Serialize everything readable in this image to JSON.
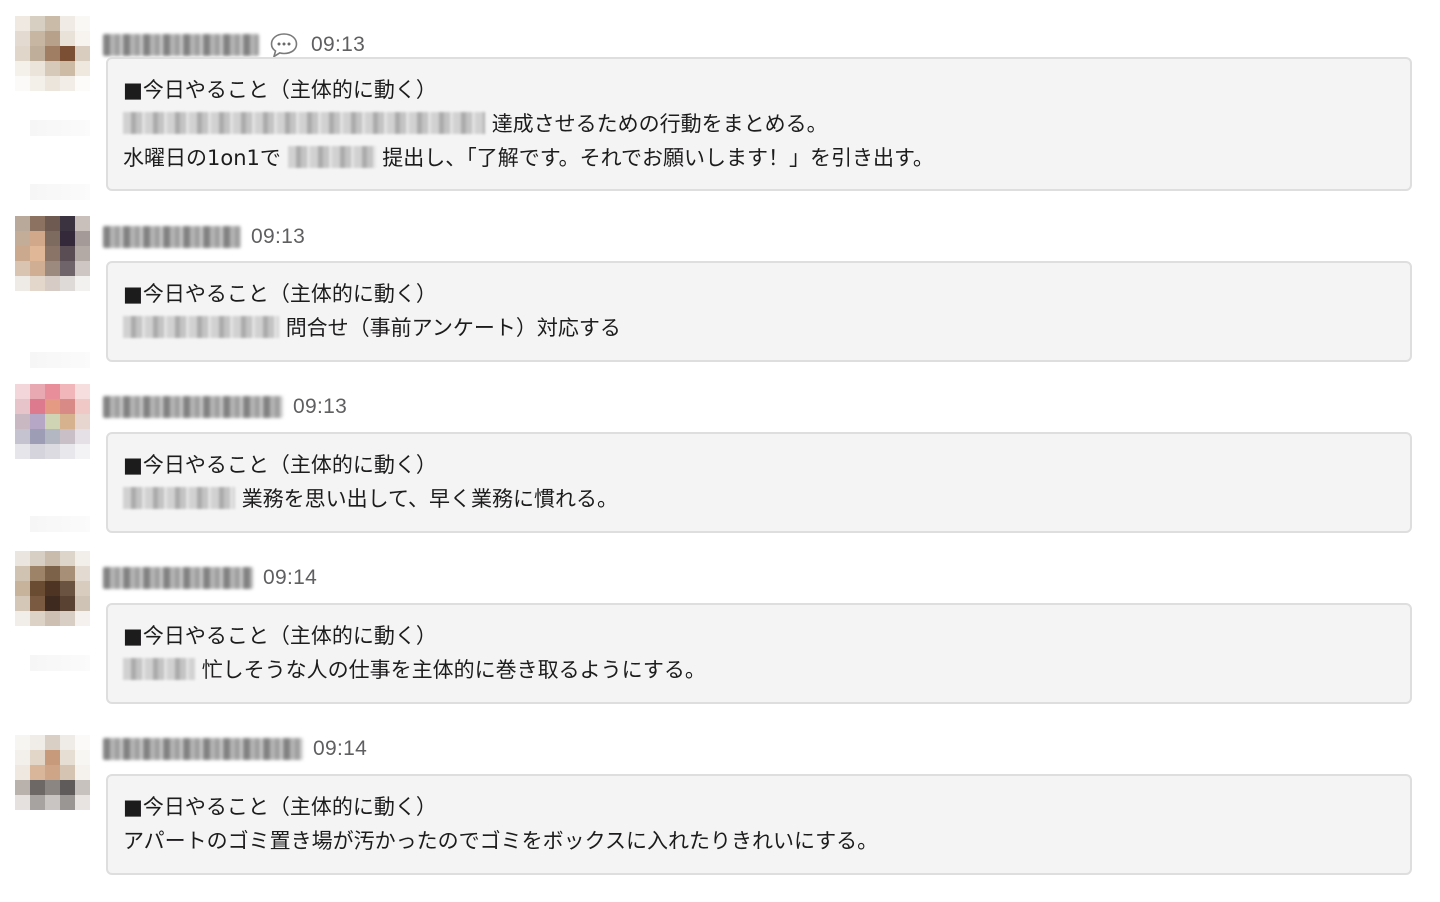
{
  "messages": [
    {
      "time": "09:13",
      "has_thread_icon": true,
      "avatar_colors": [
        "#efe9e1",
        "#d8cfc3",
        "#cabba8",
        "#f0ebe4",
        "#faf8f5",
        "#e3dbd1",
        "#c7b6a1",
        "#b7a18a",
        "#e9e2d9",
        "#f7f4f0",
        "#e1d6ca",
        "#bfae99",
        "#9f7e63",
        "#7a4f33",
        "#d9cdbf",
        "#f4f0ea",
        "#ebe4da",
        "#d6c9b9",
        "#cdbba6",
        "#efe8df",
        "#fbfaf8",
        "#f3efe9",
        "#ece5dc",
        "#f2ede7",
        "#fcfbfa"
      ],
      "lines": [
        {
          "before": "■今日やること（主体的に動く）",
          "after": ""
        },
        {
          "before": "",
          "after": "達成させるための行動をまとめる。"
        },
        {
          "before": "水曜日の1on1で",
          "after": "提出し、「了解です。それでお願いします！」を引き出す。"
        }
      ]
    },
    {
      "time": "09:13",
      "has_thread_icon": false,
      "avatar_colors": [
        "#b9a99a",
        "#8c7361",
        "#6e5a50",
        "#3c3340",
        "#c9c0bb",
        "#c4ad98",
        "#d1a98a",
        "#7d6b60",
        "#33293a",
        "#a49b99",
        "#caa98e",
        "#e0b898",
        "#8a7468",
        "#5a4d54",
        "#b4aaa5",
        "#d9c4b2",
        "#cfae93",
        "#9c8a7e",
        "#6f6469",
        "#cdc6c2",
        "#eeeae6",
        "#e3d6cb",
        "#d6ccc5",
        "#dedad7",
        "#f3f1ef"
      ],
      "lines": [
        {
          "before": "■今日やること（主体的に動く）",
          "after": ""
        },
        {
          "before": "",
          "after": "問合せ（事前アンケート）対応する"
        }
      ]
    },
    {
      "time": "09:13",
      "has_thread_icon": false,
      "avatar_colors": [
        "#f3d6da",
        "#e9a9b3",
        "#e88d9a",
        "#f1b6b9",
        "#f7dede",
        "#e7c4c9",
        "#dd7a8d",
        "#e59a83",
        "#d88a86",
        "#f0c9c6",
        "#c9b7c2",
        "#b7a7c6",
        "#cfd4b5",
        "#d6b28f",
        "#e7d5cf",
        "#c5c3cf",
        "#9d9db6",
        "#b2b7c2",
        "#c9c0c7",
        "#e4e0e6",
        "#e6e5ea",
        "#d5d4dc",
        "#dcdbe2",
        "#e8e7ec",
        "#f3f2f5"
      ],
      "lines": [
        {
          "before": "■今日やること（主体的に動く）",
          "after": ""
        },
        {
          "before": "",
          "after": "業務を思い出して、早く業務に慣れる。"
        }
      ]
    },
    {
      "time": "09:14",
      "has_thread_icon": false,
      "avatar_colors": [
        "#eae5df",
        "#d8cfc4",
        "#c9bcad",
        "#ddd4ca",
        "#f2efeb",
        "#d1c3b2",
        "#9d8367",
        "#7c6249",
        "#a68f76",
        "#e3dbd2",
        "#c7b39b",
        "#6a4c33",
        "#4e3523",
        "#6b5341",
        "#d8ccbf",
        "#d5c7b8",
        "#7a5a40",
        "#3e2a1e",
        "#5a4232",
        "#cfc3b6",
        "#f1ede8",
        "#ddd2c6",
        "#cdbfb1",
        "#d8cec4",
        "#f4f1ee"
      ],
      "lines": [
        {
          "before": "■今日やること（主体的に動く）",
          "after": ""
        },
        {
          "before": "",
          "after": "忙しそうな人の仕事を主体的に巻き取るようにする。"
        }
      ]
    },
    {
      "time": "09:14",
      "has_thread_icon": false,
      "avatar_colors": [
        "#f7f5f2",
        "#f0ece7",
        "#d9cfc4",
        "#efebe6",
        "#fbfaf8",
        "#f3efea",
        "#e2d6c9",
        "#c89a7c",
        "#e6ddd3",
        "#f8f6f3",
        "#eee8e1",
        "#d9b69a",
        "#cfa588",
        "#d6c4b3",
        "#f5f2ee",
        "#b9b2ac",
        "#6d6866",
        "#8c8682",
        "#5f5b5a",
        "#c7c2be",
        "#e4e1de",
        "#a7a3a0",
        "#c9c5c2",
        "#9a9693",
        "#e7e4e1"
      ],
      "lines": [
        {
          "before": "■今日やること（主体的に動く）",
          "after": ""
        },
        {
          "before": "アパートのゴミ置き場が汚かったのでゴミをボックスに入れたりきれいにする。",
          "after": ""
        }
      ]
    }
  ]
}
